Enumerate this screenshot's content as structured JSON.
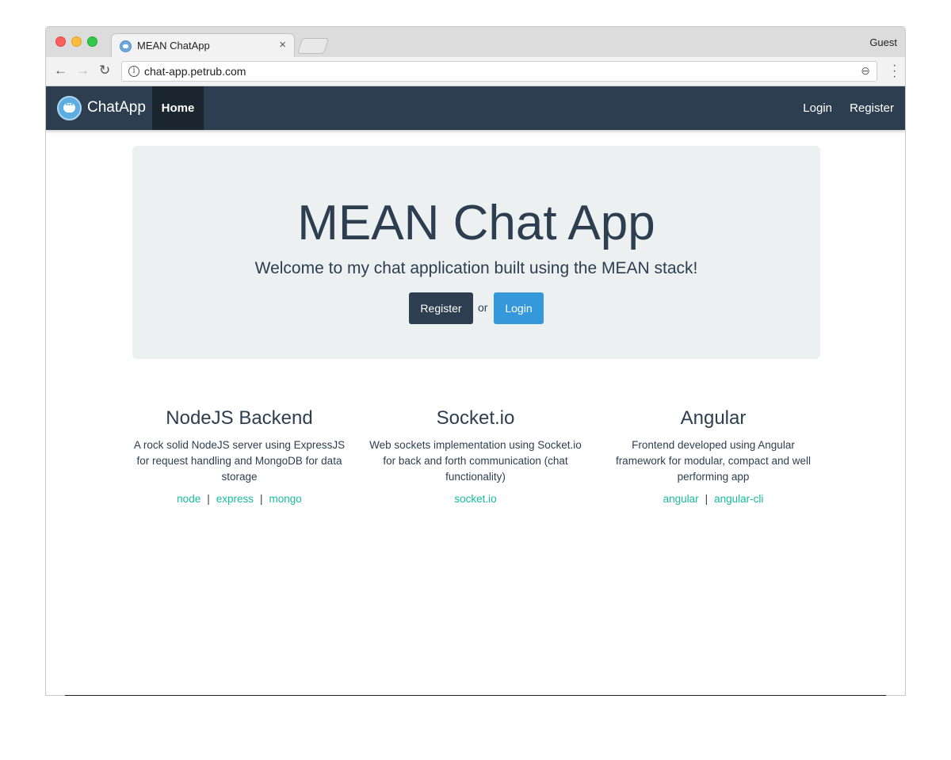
{
  "browser": {
    "tab_title": "MEAN ChatApp",
    "tab_close": "×",
    "profile": "Guest",
    "url": "chat-app.petrub.com",
    "icons": [
      "back-arrow-icon",
      "forward-arrow-icon",
      "reload-icon",
      "info-icon",
      "zoom-icon",
      "menu-icon"
    ]
  },
  "navbar": {
    "brand": "ChatApp",
    "home": "Home",
    "login": "Login",
    "register": "Register",
    "color": "#2c3e50",
    "active_color": "#1a252f"
  },
  "jumbotron": {
    "title": "MEAN Chat App",
    "lead": "Welcome to my chat application built using the MEAN stack!",
    "register_button": "Register",
    "or": "or",
    "login_button": "Login",
    "register_color": "#2c3e50",
    "login_color": "#3498db"
  },
  "features": [
    {
      "title": "NodeJS Backend",
      "description": "A rock solid NodeJS server using ExpressJS for request handling and MongoDB for data storage",
      "links": [
        "node",
        "express",
        "mongo"
      ]
    },
    {
      "title": "Socket.io",
      "description": "Web sockets implementation using Socket.io for back and forth communication (chat functionality)",
      "links": [
        "socket.io"
      ]
    },
    {
      "title": "Angular",
      "description": "Frontend developed using Angular framework for modular, compact and well performing app",
      "links": [
        "angular",
        "angular-cli"
      ]
    }
  ],
  "link_separator": "|",
  "link_color": "#18bc9c"
}
